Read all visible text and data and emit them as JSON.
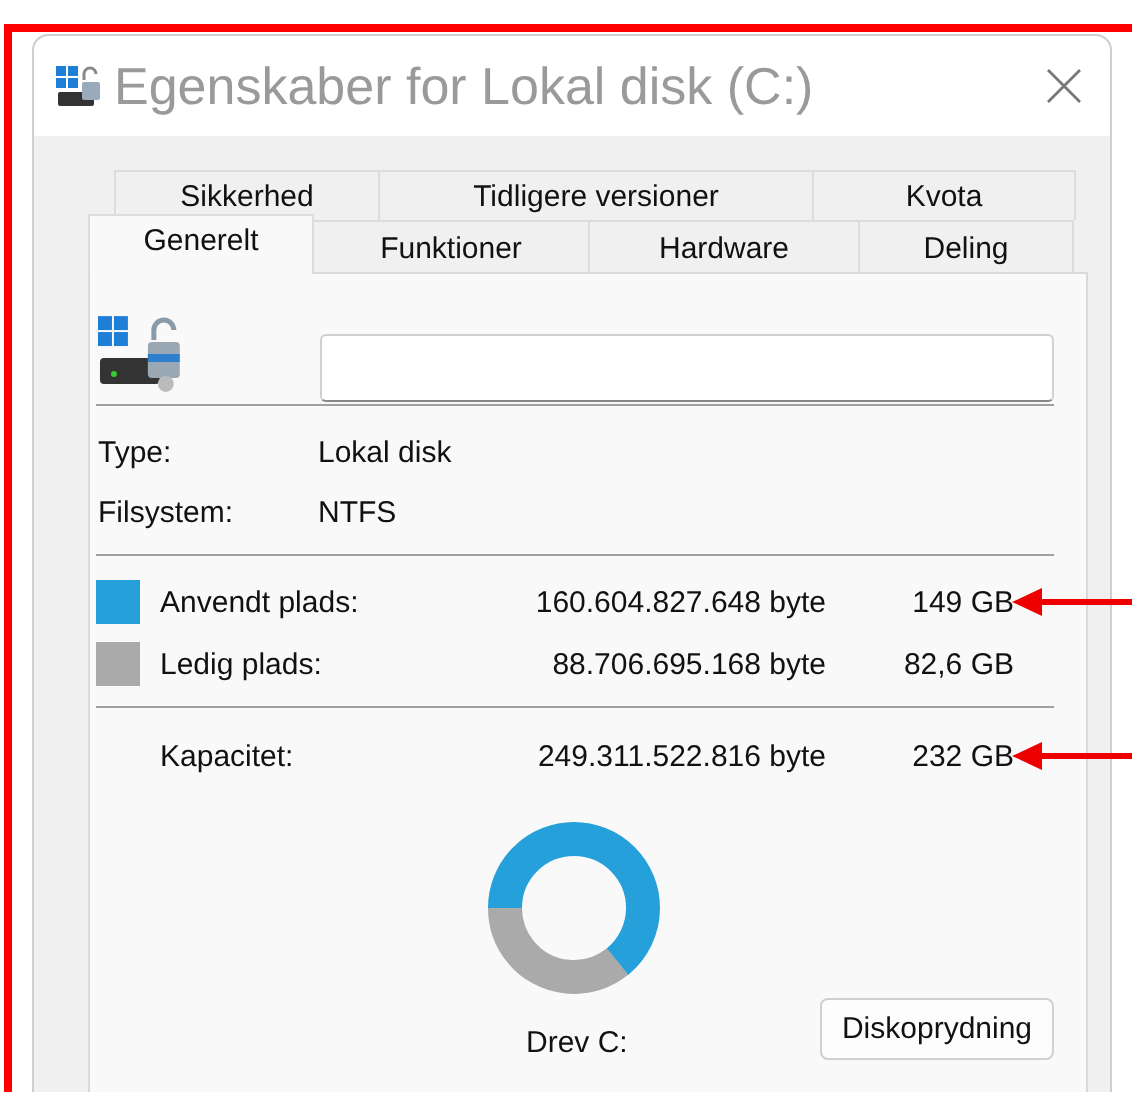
{
  "window": {
    "title": "Egenskaber for Lokal disk (C:)"
  },
  "tab_rows": [
    {
      "tabs": [
        {
          "label": "Sikkerhed",
          "selected": false
        },
        {
          "label": "Tidligere versioner",
          "selected": false
        },
        {
          "label": "Kvota",
          "selected": false
        }
      ]
    },
    {
      "tabs": [
        {
          "label": "Generelt",
          "selected": true
        },
        {
          "label": "Funktioner",
          "selected": false
        },
        {
          "label": "Hardware",
          "selected": false
        },
        {
          "label": "Deling",
          "selected": false
        }
      ]
    }
  ],
  "info": [
    {
      "label": "Type:",
      "value": "Lokal disk"
    },
    {
      "label": "Filsystem:",
      "value": "NTFS"
    }
  ],
  "space": [
    {
      "kind": "used",
      "label": "Anvendt plads:",
      "bytes": "160.604.827.648 byte",
      "size": "149 GB",
      "color": "#26a0da",
      "highlighted": true
    },
    {
      "kind": "free",
      "label": "Ledig plads:",
      "bytes": "88.706.695.168 byte",
      "size": "82,6 GB",
      "color": "#aaaaaa",
      "highlighted": false
    },
    {
      "kind": "total",
      "label": "Kapacitet:",
      "bytes": "249.311.522.816 byte",
      "size": "232 GB",
      "highlighted": true
    }
  ],
  "usage": {
    "level": 0.64
  },
  "drive_label": "Drev C:",
  "cleanup_button": "Diskoprydning",
  "annotation_frame": true
}
